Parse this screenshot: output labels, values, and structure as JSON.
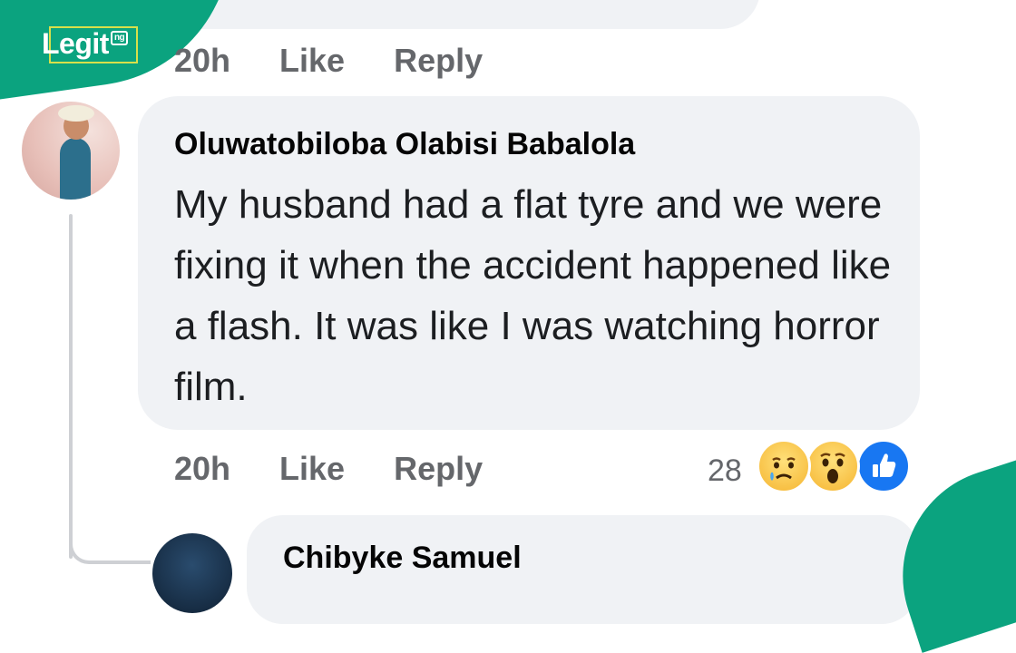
{
  "brand": {
    "logo_text": "Legit",
    "logo_suffix": "ng"
  },
  "previous_comment": {
    "actions": {
      "time": "20h",
      "like": "Like",
      "reply": "Reply"
    }
  },
  "comment": {
    "author": "Oluwatobiloba Olabisi Babalola",
    "text": "My husband had a flat tyre and we were fixing it when the accident happened like a flash. It was like I was watching horror film.",
    "actions": {
      "time": "20h",
      "like": "Like",
      "reply": "Reply"
    },
    "reaction_count": "28",
    "reactions": [
      "sad-reaction-icon",
      "wow-reaction-icon",
      "like-reaction-icon"
    ]
  },
  "reply": {
    "author": "Chibyke Samuel"
  },
  "colors": {
    "brand_green": "#0ba37f",
    "bubble_bg": "#f0f2f5",
    "meta_gray": "#65676b",
    "like_blue": "#1877f2"
  }
}
